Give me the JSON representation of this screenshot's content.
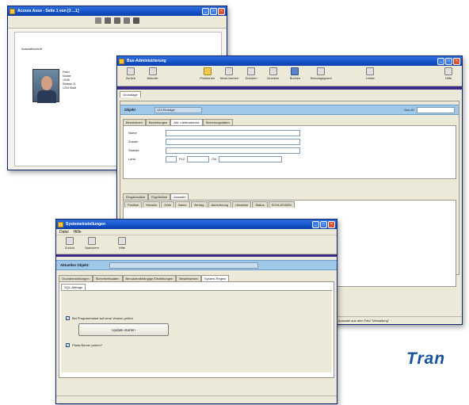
{
  "back_window": {
    "title": "Access Asso - Seite 1 von [3 ...1]",
    "header_label": "Auswahlschritt",
    "person_lines": [
      "Franz",
      "Muster",
      "10/08",
      "Strasse 21",
      "1234 Stadt"
    ]
  },
  "mid_window": {
    "title": "Bus-Administrierung",
    "toolbar": [
      {
        "label": "Zurück",
        "icon": "back-icon"
      },
      {
        "label": "Aktuelle",
        "icon": "refresh-icon"
      },
      {
        "label": "Positionen",
        "icon": "lightbulb-icon"
      },
      {
        "label": "Neu/Löschen",
        "icon": "new-delete-icon"
      },
      {
        "label": "Drucken",
        "icon": "print-icon"
      },
      {
        "label": "Drucken",
        "icon": "printer-icon"
      },
      {
        "label": "Buchen",
        "icon": "book-icon"
      },
      {
        "label": "Setzungsgrund",
        "icon": "settings-icon"
      },
      {
        "label": "Leiste",
        "icon": "list-icon"
      },
      {
        "label": "Hilfe",
        "icon": "help-icon"
      }
    ],
    "sub_tab": "Grundlage",
    "object_label": "Objekt",
    "object_value": "123 Einträge",
    "id_label": "Geo-ID",
    "tabs": [
      "Bezeichnen",
      "Beziehungen",
      "Abt. Lieferadresse",
      "Sicherungsdaten"
    ],
    "fields": [
      {
        "label": "Name"
      },
      {
        "label": "Zusatz"
      },
      {
        "label": "Strasse"
      },
      {
        "label": "Land",
        "plz_label": "PLZ",
        "ort_label": "Ort"
      }
    ],
    "lower_tabs": [
      "Eingabesätze",
      "Ergebnisse",
      "Auswahl"
    ],
    "grid_headers": [
      "Position",
      "Hinweis",
      "Zeile",
      "Name",
      "Vertrag",
      "Abrechnung",
      "Hinweise",
      "Status",
      "SCHLIESSEN"
    ],
    "status_text": "Auswahl aus dem Feld \"Verwaltung\""
  },
  "front_window": {
    "title": "Systemeinstellungen",
    "menu": [
      "Datei",
      "Hilfe"
    ],
    "toolbar": [
      {
        "label": "Zurück",
        "icon": "back-icon"
      },
      {
        "label": "Speichern",
        "icon": "save-icon"
      },
      {
        "label": "Hilfe",
        "icon": "help-icon"
      }
    ],
    "bar_label": "Aktuelles Objekt:",
    "tabs": [
      "Grundeinstellungen",
      "Sicherheitsdaten",
      "Benutzerabhängige Einstellungen",
      "Bestellwesen",
      "System-Regeln"
    ],
    "inner_tab": "SQL-Abfrage",
    "check1_label": "Bei Programmstart auf neue Version prüfen",
    "update_button": "Update starten",
    "check2_label": "Pfade/Server prüfen?"
  },
  "page_text": "Tran"
}
